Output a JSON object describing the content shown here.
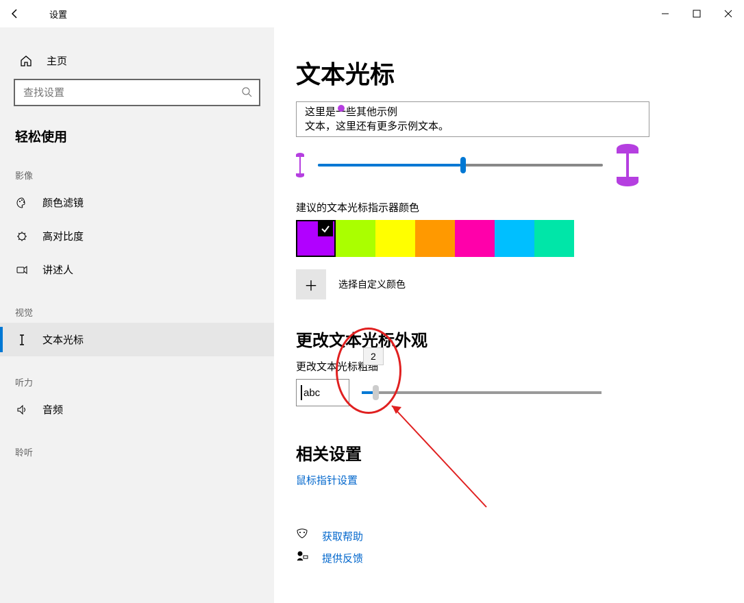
{
  "titlebar": {
    "app_title": "设置"
  },
  "sidebar": {
    "home_label": "主页",
    "search_placeholder": "查找设置",
    "section_label": "轻松使用",
    "groups": {
      "g1_label": "影像",
      "g1_items": [
        "颜色滤镜",
        "高对比度",
        "讲述人"
      ],
      "g2_label": "视觉",
      "g2_items": [
        "文本光标"
      ],
      "g3_label": "听力",
      "g3_items": [
        "音频"
      ],
      "g4_label": "聆听"
    }
  },
  "main": {
    "page_title": "文本光标",
    "sample_line1": "这里是一些其他示例",
    "sample_line2": "文本，这里还有更多示例文本。",
    "color_heading": "建议的文本光标指示器颜色",
    "swatches": [
      "#b100ff",
      "#aaff00",
      "#ffff00",
      "#ff9900",
      "#ff00aa",
      "#00bfff",
      "#00e6a8"
    ],
    "selected_swatch_index": 0,
    "custom_color_label": "选择自定义颜色",
    "appearance_heading": "更改文本光标外观",
    "thickness_label": "更改文本光标粗细",
    "thickness_value": "2",
    "thickness_sample": "abc",
    "indicator_slider_percent": 50,
    "related_heading": "相关设置",
    "related_link": "鼠标指针设置",
    "help_label": "获取帮助",
    "feedback_label": "提供反馈"
  }
}
